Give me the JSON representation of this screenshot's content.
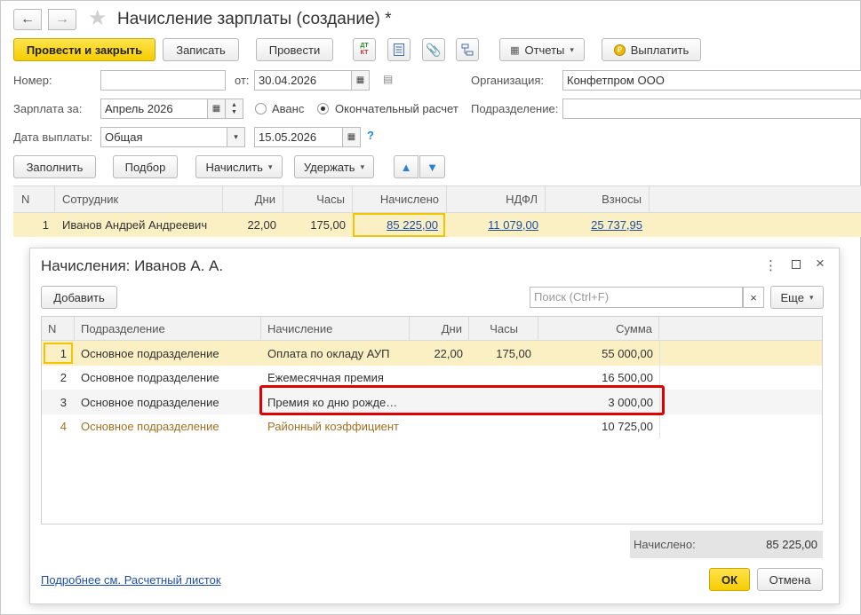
{
  "window": {
    "title": "Начисление зарплаты (создание) *"
  },
  "toolbar": {
    "post_close": "Провести и закрыть",
    "save": "Записать",
    "post": "Провести",
    "reports": "Отчеты",
    "pay": "Выплатить"
  },
  "form": {
    "number_label": "Номер:",
    "number_value": "",
    "from_label": "от:",
    "date_value": "30.04.2026",
    "org_label": "Организация:",
    "org_value": "Конфетпром ООО",
    "salary_for_label": "Зарплата за:",
    "salary_for_value": "Апрель 2026",
    "advance_label": "Аванс",
    "final_label": "Окончательный расчет",
    "division_label": "Подразделение:",
    "division_value": "",
    "pay_date_label": "Дата выплаты:",
    "pay_date_type": "Общая",
    "pay_date_value": "15.05.2026",
    "help": "?"
  },
  "actions": {
    "fill": "Заполнить",
    "select": "Подбор",
    "accrue": "Начислить",
    "withhold": "Удержать"
  },
  "main_table": {
    "headers": [
      "N",
      "Сотрудник",
      "Дни",
      "Часы",
      "Начислено",
      "НДФЛ",
      "Взносы"
    ],
    "rows": [
      {
        "n": "1",
        "employee": "Иванов Андрей Андреевич",
        "days": "22,00",
        "hours": "175,00",
        "accrued": "85 225,00",
        "ndfl": "11 079,00",
        "contrib": "25 737,95"
      }
    ]
  },
  "dialog": {
    "title": "Начисления: Иванов А. А.",
    "add": "Добавить",
    "search_placeholder": "Поиск (Ctrl+F)",
    "more": "Еще",
    "headers": [
      "N",
      "Подразделение",
      "Начисление",
      "Дни",
      "Часы",
      "Сумма"
    ],
    "rows": [
      {
        "n": "1",
        "division": "Основное подразделение",
        "accrual": "Оплата по окладу АУП",
        "days": "22,00",
        "hours": "175,00",
        "sum": "55 000,00"
      },
      {
        "n": "2",
        "division": "Основное подразделение",
        "accrual": "Ежемесячная премия",
        "days": "",
        "hours": "",
        "sum": "16 500,00"
      },
      {
        "n": "3",
        "division": "Основное подразделение",
        "accrual": "Премия ко дню рожде…",
        "days": "",
        "hours": "",
        "sum": "3 000,00"
      },
      {
        "n": "4",
        "division": "Основное подразделение",
        "accrual": "Районный коэффициент",
        "days": "",
        "hours": "",
        "sum": "10 725,00"
      }
    ],
    "total_label": "Начислено:",
    "total_value": "85 225,00",
    "details_link": "Подробнее см. Расчетный листок",
    "ok": "ОК",
    "cancel": "Отмена"
  },
  "colors": {
    "accent_yellow": "#f5cd00",
    "selected_row": "#fbefc4",
    "link": "#1f4fa3",
    "highlight": "#e00000",
    "brown_text": "#a07020"
  }
}
